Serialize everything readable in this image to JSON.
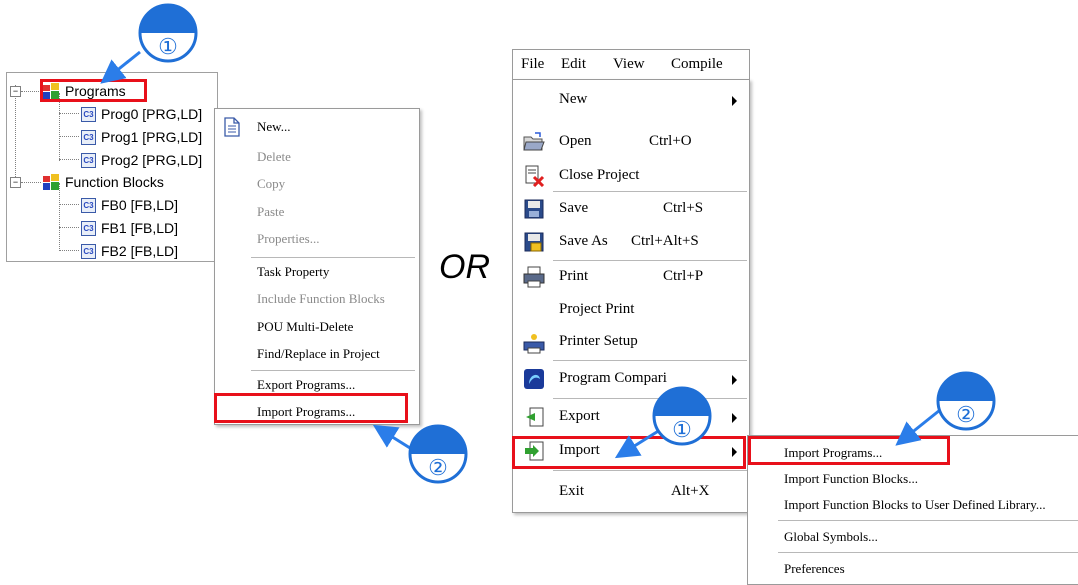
{
  "tree": {
    "programs": "Programs",
    "prog0": "Prog0 [PRG,LD]",
    "prog1": "Prog1 [PRG,LD]",
    "prog2": "Prog2 [PRG,LD]",
    "function_blocks": "Function Blocks",
    "fb0": "FB0 [FB,LD]",
    "fb1": "FB1 [FB,LD]",
    "fb2": "FB2 [FB,LD]",
    "pou_icon_glyph": "C3"
  },
  "context_menu": {
    "new": "New...",
    "delete": "Delete",
    "copy": "Copy",
    "paste": "Paste",
    "properties": "Properties...",
    "task_property": "Task Property",
    "include_function_blocks": "Include Function Blocks",
    "pou_multi_delete": "POU Multi-Delete",
    "find_replace": "Find/Replace in Project",
    "export_programs": "Export Programs...",
    "import_programs": "Import Programs..."
  },
  "or_label": "OR",
  "menubar": {
    "file": "File",
    "edit": "Edit",
    "view": "View",
    "compile": "Compile"
  },
  "file_menu": {
    "new": "New",
    "open": "Open",
    "open_shortcut": "Ctrl+O",
    "close_project": "Close Project",
    "save": "Save",
    "save_shortcut": "Ctrl+S",
    "save_as": "Save As",
    "save_as_shortcut": "Ctrl+Alt+S",
    "print": "Print",
    "print_shortcut": "Ctrl+P",
    "project_print": "Project Print",
    "printer_setup": "Printer Setup",
    "program_comparison": "Program Compari",
    "export": "Export",
    "import": "Import",
    "exit": "Exit",
    "exit_shortcut": "Alt+X"
  },
  "import_submenu": {
    "import_programs": "Import Programs...",
    "import_function_blocks": "Import Function Blocks...",
    "import_fb_to_library": "Import Function Blocks to User Defined Library...",
    "global_symbols": "Global Symbols...",
    "preferences": "Preferences"
  },
  "steps": {
    "one": "①",
    "two": "②"
  },
  "colors": {
    "highlight": "#e8101a",
    "badge_blue": "#1f6fd6",
    "arrow_blue": "#2b7de9"
  }
}
